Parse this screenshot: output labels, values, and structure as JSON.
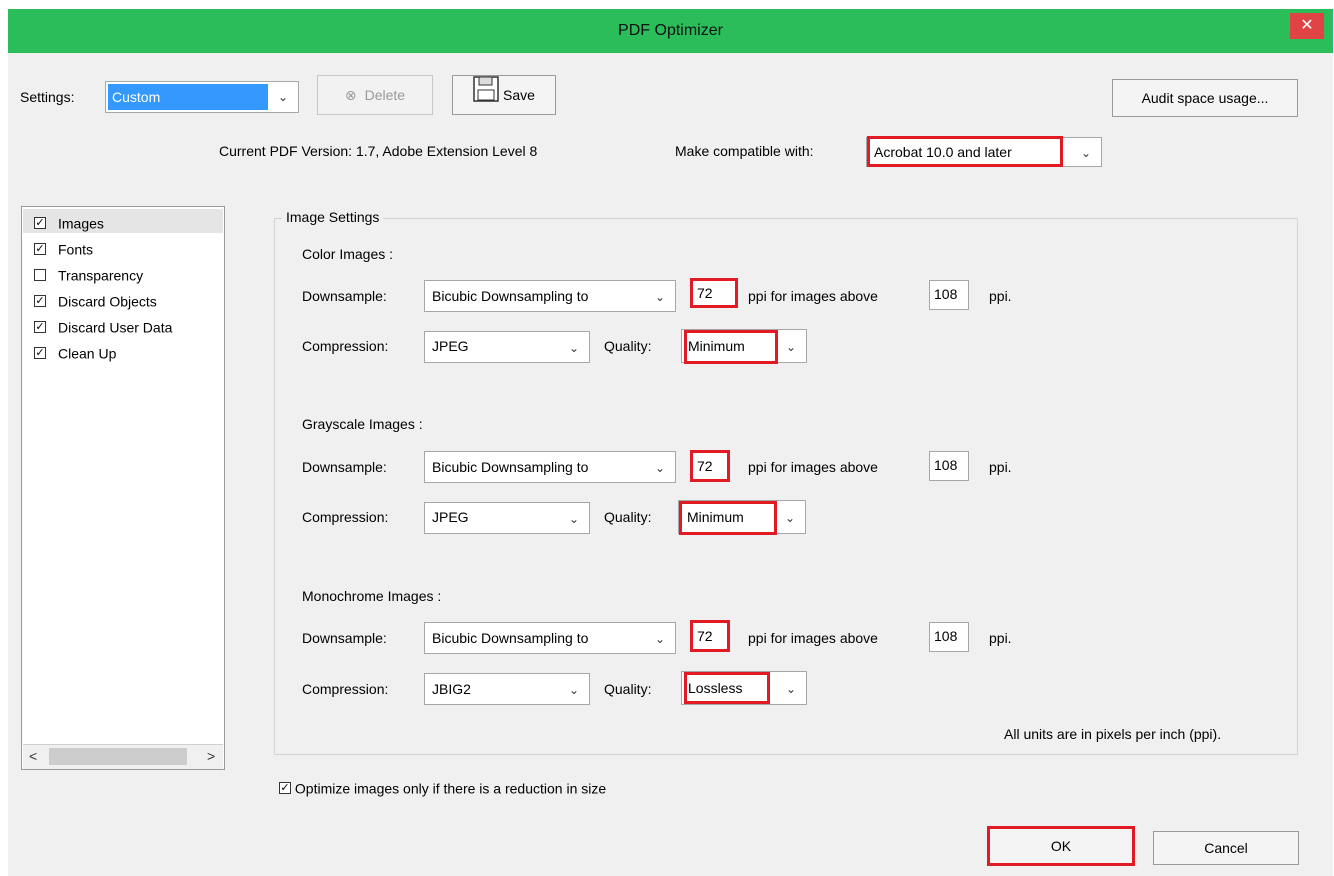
{
  "window": {
    "title": "PDF Optimizer",
    "close_glyph": "✕"
  },
  "toolbar": {
    "settings_label": "Settings:",
    "settings_value": "Custom",
    "delete_label": "Delete",
    "save_label": "Save",
    "audit_label": "Audit space usage..."
  },
  "version": {
    "current": "Current PDF Version: 1.7, Adobe Extension Level 8",
    "compat_label": "Make compatible with:",
    "compat_value": "Acrobat 10.0 and later"
  },
  "sidebar": {
    "items": [
      {
        "label": "Images",
        "checked": true,
        "selected": true
      },
      {
        "label": "Fonts",
        "checked": true
      },
      {
        "label": "Transparency",
        "checked": false
      },
      {
        "label": "Discard Objects",
        "checked": true
      },
      {
        "label": "Discard User Data",
        "checked": true
      },
      {
        "label": "Clean Up",
        "checked": true
      }
    ],
    "scroll_left": "<",
    "scroll_right": ">"
  },
  "image_settings": {
    "title": "Image Settings",
    "downsample_label": "Downsample:",
    "compression_label": "Compression:",
    "quality_label": "Quality:",
    "ppi_above_label": "ppi for images above",
    "ppi_label": "ppi.",
    "color": {
      "heading": "Color Images :",
      "downsample": "Bicubic Downsampling to",
      "ppi": "72",
      "above": "108",
      "compression": "JPEG",
      "quality": "Minimum"
    },
    "grayscale": {
      "heading": "Grayscale Images :",
      "downsample": "Bicubic Downsampling to",
      "ppi": "72",
      "above": "108",
      "compression": "JPEG",
      "quality": "Minimum"
    },
    "mono": {
      "heading": "Monochrome Images :",
      "downsample": "Bicubic Downsampling to",
      "ppi": "72",
      "above": "108",
      "compression": "JBIG2",
      "quality": "Lossless"
    },
    "units_note": "All units are in pixels per inch (ppi)."
  },
  "optimize_only_if_reduction": {
    "label": "Optimize images only if there is a reduction in size",
    "checked": true
  },
  "footer": {
    "ok_label": "OK",
    "cancel_label": "Cancel"
  },
  "icons": {
    "check_glyph": "✓",
    "dropdown_glyph": "⌄",
    "delete_glyph": "⊗",
    "save_glyph": "floppy-disk"
  },
  "colors": {
    "titlebar": "#2bbd5a",
    "close": "#e04343",
    "selection": "#3399ff",
    "highlight": "#e01b24"
  }
}
